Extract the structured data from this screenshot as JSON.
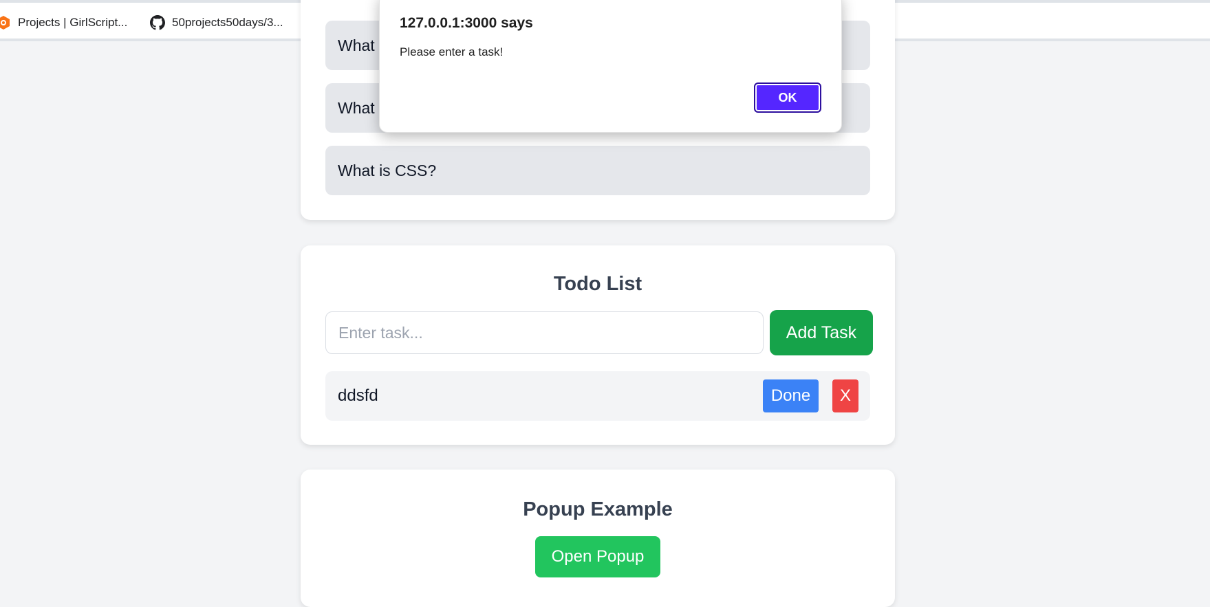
{
  "bookmarks": [
    {
      "label": "Projects | GirlScript...",
      "icon": "girlscript-icon"
    },
    {
      "label": "50projects50days/3...",
      "icon": "github-icon"
    }
  ],
  "faq": {
    "items": [
      {
        "label": "What"
      },
      {
        "label": "What"
      },
      {
        "label": "What is CSS?"
      }
    ]
  },
  "todo": {
    "title": "Todo List",
    "input_placeholder": "Enter task...",
    "input_value": "",
    "add_label": "Add Task",
    "tasks": [
      {
        "text": "ddsfd",
        "done_label": "Done",
        "delete_label": "X"
      }
    ]
  },
  "popup": {
    "title": "Popup Example",
    "open_label": "Open Popup"
  },
  "alert": {
    "title": "127.0.0.1:3000 says",
    "message": "Please enter a task!",
    "ok_label": "OK"
  },
  "colors": {
    "page_bg": "#f3f4f6",
    "add_button": "#16a34a",
    "done_button": "#3b82f6",
    "delete_button": "#ef4444",
    "open_popup_button": "#22c55e",
    "alert_ok": "#5526ff"
  }
}
